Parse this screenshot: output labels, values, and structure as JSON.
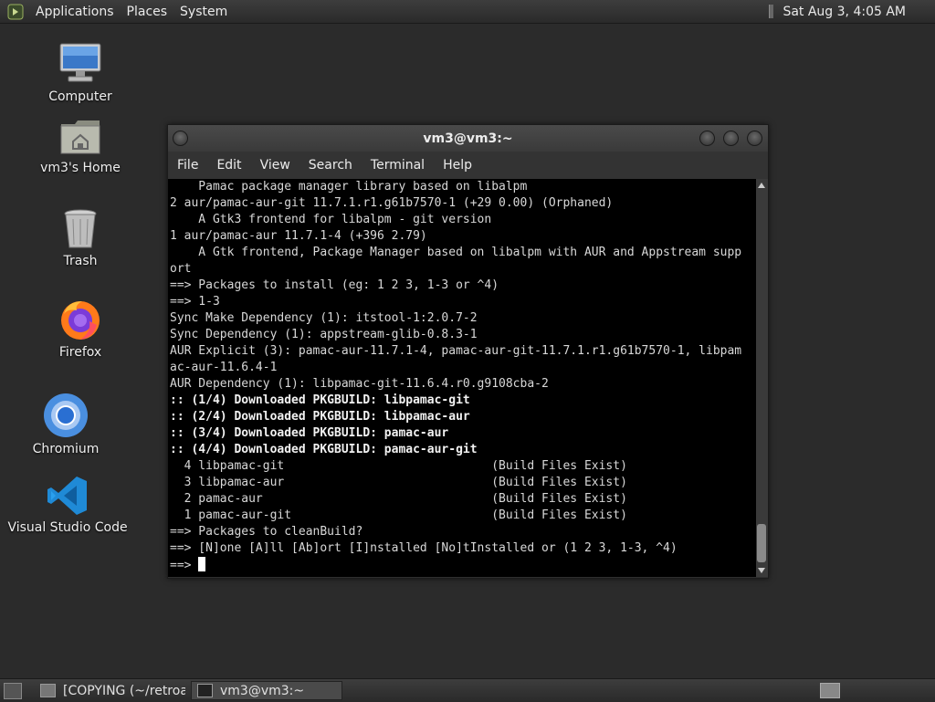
{
  "top_panel": {
    "menus": [
      "Applications",
      "Places",
      "System"
    ],
    "clock": "Sat Aug  3,  4:05 AM"
  },
  "desktop": {
    "icons": [
      {
        "label": "Computer",
        "icon": "monitor-icon"
      },
      {
        "label": "vm3's Home",
        "icon": "home-folder-icon"
      },
      {
        "label": "Trash",
        "icon": "trash-icon"
      },
      {
        "label": "Firefox",
        "icon": "firefox-icon"
      },
      {
        "label": "Chromium",
        "icon": "chromium-icon"
      },
      {
        "label": "Visual Studio Code",
        "icon": "vscode-icon"
      }
    ]
  },
  "window": {
    "title": "vm3@vm3:~",
    "menu": [
      "File",
      "Edit",
      "View",
      "Search",
      "Terminal",
      "Help"
    ],
    "lines": [
      "    Pamac package manager library based on libalpm",
      "2 aur/pamac-aur-git 11.7.1.r1.g61b7570-1 (+29 0.00) (Orphaned)",
      "    A Gtk3 frontend for libalpm - git version",
      "1 aur/pamac-aur 11.7.1-4 (+396 2.79)",
      "    A Gtk frontend, Package Manager based on libalpm with AUR and Appstream supp",
      "ort",
      "==> Packages to install (eg: 1 2 3, 1-3 or ^4)",
      "==> 1-3",
      "Sync Make Dependency (1): itstool-1:2.0.7-2",
      "Sync Dependency (1): appstream-glib-0.8.3-1",
      "AUR Explicit (3): pamac-aur-11.7.1-4, pamac-aur-git-11.7.1.r1.g61b7570-1, libpam",
      "ac-aur-11.6.4-1",
      "AUR Dependency (1): libpamac-git-11.6.4.r0.g9108cba-2",
      ":: (1/4) Downloaded PKGBUILD: libpamac-git",
      ":: (2/4) Downloaded PKGBUILD: libpamac-aur",
      ":: (3/4) Downloaded PKGBUILD: pamac-aur",
      ":: (4/4) Downloaded PKGBUILD: pamac-aur-git",
      "  4 libpamac-git                             (Build Files Exist)",
      "  3 libpamac-aur                             (Build Files Exist)",
      "  2 pamac-aur                                (Build Files Exist)",
      "  1 pamac-aur-git                            (Build Files Exist)",
      "==> Packages to cleanBuild?",
      "==> [N]one [A]ll [Ab]ort [I]nstalled [No]tInstalled or (1 2 3, 1-3, ^4)"
    ],
    "prompt": "==> "
  },
  "taskbar": {
    "tasks": [
      {
        "label": "[COPYING (~/retroa...",
        "active": false
      },
      {
        "label": "vm3@vm3:~",
        "active": true
      }
    ]
  }
}
